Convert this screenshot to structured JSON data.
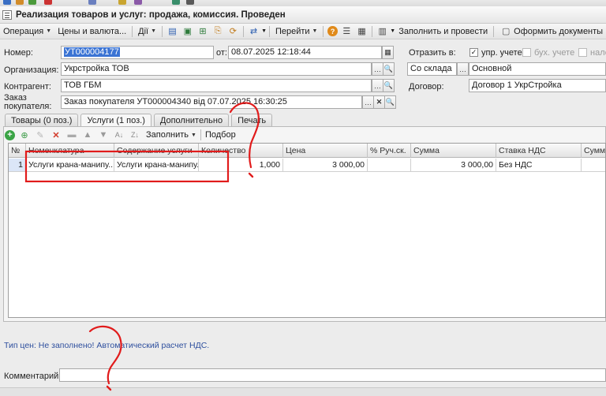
{
  "window": {
    "title": "Реализация товаров и услуг: продажа, комиссия. Проведен"
  },
  "command_bar": {
    "operation": "Операция",
    "prices": "Цены и валюта...",
    "actions": "Дії",
    "goto": "Перейти",
    "fill_and_post": "Заполнить и провести",
    "make_documents": "Оформить документы"
  },
  "form": {
    "number_label": "Номер:",
    "number_value": "УТ000004177",
    "from_label": "от:",
    "date_value": "08.07.2025 12:18:44",
    "reflect_label": "Отразить в:",
    "mgmt_accounting": "упр. учете",
    "accounting": "бух. учете",
    "tax": "налог",
    "org_label": "Организация:",
    "org_value": "Укрстройка ТОВ",
    "warehouse_type": "Со склада",
    "warehouse_value": "Основной",
    "counterparty_label": "Контрагент:",
    "counterparty_value": "ТОВ ГБМ",
    "contract_label": "Договор:",
    "contract_value": "Договор 1 УкрСтройка",
    "order_label_1": "Заказ",
    "order_label_2": "покупателя:",
    "order_value": "Заказ покупателя УТ000004340 від 07.07.2025 16:30:25"
  },
  "tabs": [
    {
      "label": "Товары (0 поз.)"
    },
    {
      "label": "Услуги (1 поз.)"
    },
    {
      "label": "Дополнительно"
    },
    {
      "label": "Печать"
    }
  ],
  "table_toolbar": {
    "fill": "Заполнить",
    "select": "Подбор"
  },
  "table": {
    "headers": [
      "№",
      "Номенклатура",
      "Содержание услуги",
      "Количество",
      "Цена",
      "% Руч.ск.",
      "Сумма",
      "Ставка НДС",
      "Сумма"
    ],
    "rows": [
      [
        "1",
        "Услуги крана-манипу...",
        "Услуги крана-манипу...",
        "1,000",
        "3 000,00",
        "",
        "3 000,00",
        "Без НДС",
        ""
      ]
    ]
  },
  "info": {
    "text": "Тип цен: Не заполнено! Автоматический расчет НДС."
  },
  "comment": {
    "label": "Комментарий:",
    "value": ""
  },
  "annotations": {
    "color": "#e11b1b"
  }
}
